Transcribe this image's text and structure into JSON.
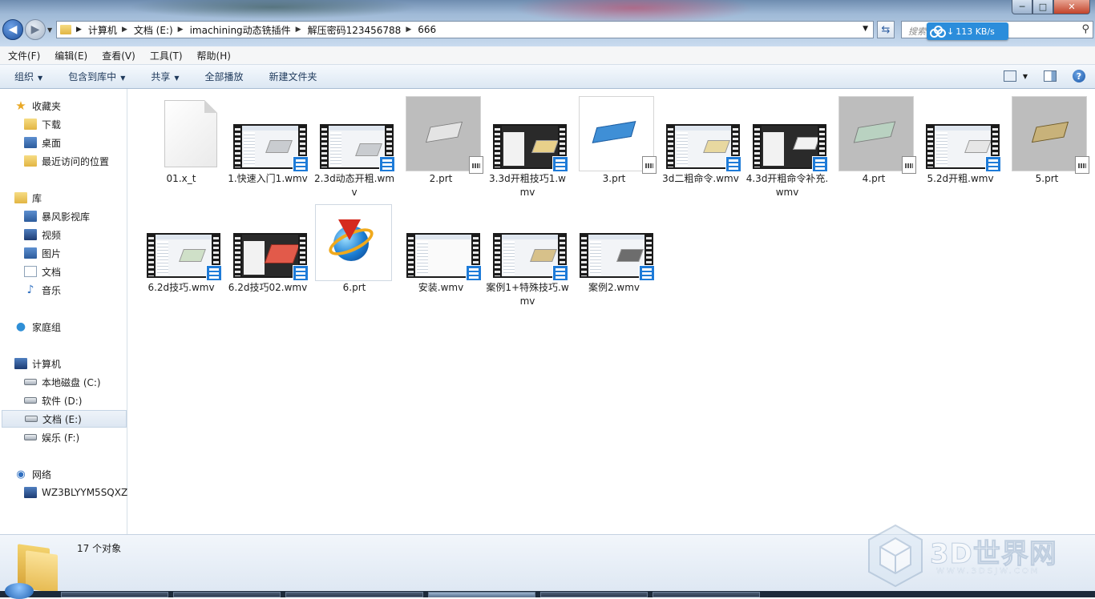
{
  "window": {
    "controls": {
      "minimize": "─",
      "maximize": "□",
      "close": "✕"
    }
  },
  "address_bar": {
    "crumbs": [
      "计算机",
      "文档 (E:)",
      "imachining动态铣插件",
      "解压密码123456788",
      "666"
    ],
    "search_placeholder": "搜索 666"
  },
  "download_badge": {
    "speed": "113 KB/s",
    "icon": "baidu-cloud-icon"
  },
  "menu": [
    "文件(F)",
    "编辑(E)",
    "查看(V)",
    "工具(T)",
    "帮助(H)"
  ],
  "toolbar": {
    "organize": "组织",
    "include_library": "包含到库中",
    "share": "共享",
    "play_all": "全部播放",
    "new_folder": "新建文件夹",
    "help": "?"
  },
  "nav": {
    "favorites": "收藏夹",
    "downloads": "下载",
    "desktop": "桌面",
    "recent": "最近访问的位置",
    "libraries": "库",
    "storm": "暴风影视库",
    "videos": "视频",
    "pictures": "图片",
    "documents": "文档",
    "music": "音乐",
    "homegroup": "家庭组",
    "computer": "计算机",
    "drive_c": "本地磁盘 (C:)",
    "drive_d": "软件 (D:)",
    "drive_e": "文档 (E:)",
    "drive_f": "娱乐 (F:)",
    "network": "网络",
    "pc_name": "WZ3BLYYM5SQXZ"
  },
  "files": [
    {
      "name": "01.x_t",
      "kind": "doc"
    },
    {
      "name": "1.快速入门1.wmv",
      "kind": "video"
    },
    {
      "name": "2.3d动态开粗.wmv",
      "kind": "video"
    },
    {
      "name": "2.prt",
      "kind": "prt"
    },
    {
      "name": "3.3d开粗技巧1.wmv",
      "kind": "video"
    },
    {
      "name": "3.prt",
      "kind": "prt"
    },
    {
      "name": "3d二粗命令.wmv",
      "kind": "video"
    },
    {
      "name": "4.3d开粗命令补充.wmv",
      "kind": "video"
    },
    {
      "name": "4.prt",
      "kind": "prt"
    },
    {
      "name": "5.2d开粗.wmv",
      "kind": "video"
    },
    {
      "name": "5.prt",
      "kind": "prt"
    },
    {
      "name": "6.2d技巧.wmv",
      "kind": "video"
    },
    {
      "name": "6.2d技巧02.wmv",
      "kind": "video"
    },
    {
      "name": "6.prt",
      "kind": "app"
    },
    {
      "name": "安装.wmv",
      "kind": "video"
    },
    {
      "name": "案例1+特殊技巧.wmv",
      "kind": "video"
    },
    {
      "name": "案例2.wmv",
      "kind": "video"
    }
  ],
  "status": {
    "count": "17 个对象"
  },
  "watermark": {
    "text": "3D世界网",
    "url": "WWW.3DSJW.COM"
  },
  "colors": {
    "prt_part_2": "#e4e4e4",
    "prt_part_3": "#3f8fd6",
    "prt_part_4": "#b9d2c1",
    "prt_part_5": "#c8b27a",
    "video_badge": "#1e7bd8"
  }
}
